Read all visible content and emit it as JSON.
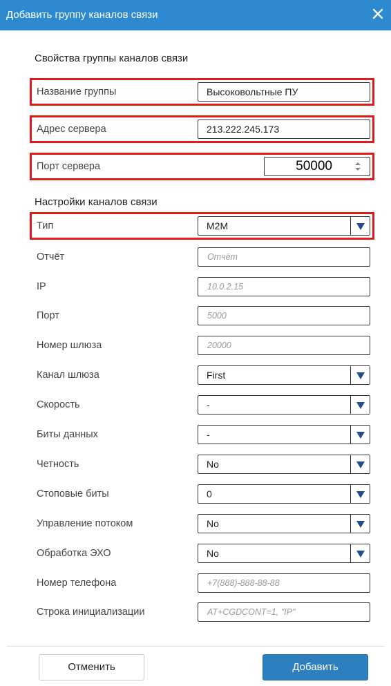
{
  "dialog": {
    "title": "Добавить группу каналов связи",
    "icon_close": "close-icon"
  },
  "sections": {
    "group_props": "Свойства группы каналов связи",
    "channel_settings": "Настройки каналов связи"
  },
  "group_fields": [
    {
      "label": "Название группы",
      "value": "Высоковольтные ПУ"
    },
    {
      "label": "Адрес сервера",
      "value": "213.222.245.173"
    },
    {
      "label": "Порт сервера",
      "value": "50000"
    }
  ],
  "channel_fields": {
    "type": {
      "label": "Тип",
      "value": "M2M"
    },
    "report": {
      "label": "Отчёт",
      "placeholder": "Отчёт"
    },
    "ip": {
      "label": "IP",
      "placeholder": "10.0.2.15"
    },
    "port": {
      "label": "Порт",
      "placeholder": "5000"
    },
    "gateway_number": {
      "label": "Номер шлюза",
      "placeholder": "20000"
    },
    "gateway_channel": {
      "label": "Канал шлюза",
      "value": "First"
    },
    "speed": {
      "label": "Скорость",
      "value": "-"
    },
    "data_bits": {
      "label": "Биты данных",
      "value": "-"
    },
    "parity": {
      "label": "Четность",
      "value": "No"
    },
    "stop_bits": {
      "label": "Стоповые биты",
      "value": "0"
    },
    "flow_control": {
      "label": "Управление потоком",
      "value": "No"
    },
    "echo": {
      "label": "Обработка ЭХО",
      "value": "No"
    },
    "phone": {
      "label": "Номер телефона",
      "placeholder": "+7(888)-888-88-88"
    },
    "init_string": {
      "label": "Строка инициализации",
      "placeholder": "AT+CGDCONT=1, \"IP\""
    }
  },
  "buttons": {
    "cancel": "Отменить",
    "add": "Добавить"
  },
  "colors": {
    "titlebar": "#2d8ad0",
    "highlight": "#e01a1a",
    "primary_button": "#2d7fc0"
  }
}
